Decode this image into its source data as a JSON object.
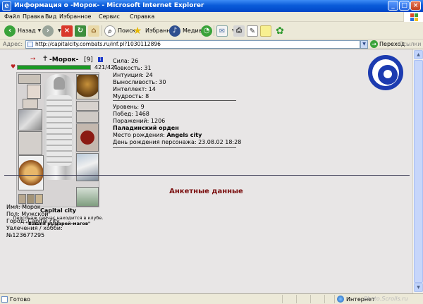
{
  "window": {
    "title": "Информация о -Морок- - Microsoft Internet Explorer",
    "controls": {
      "minimize": "_",
      "maximize": "□",
      "close": "×"
    }
  },
  "menu": [
    "Файл",
    "Правка",
    "Вид",
    "Избранное",
    "Сервис",
    "Справка"
  ],
  "toolbar": {
    "back": "Назад",
    "search": "Поиск",
    "favorites": "Избранное",
    "media": "Медиа"
  },
  "address": {
    "label": "Адрес:",
    "url": "http://capitalcity.combats.ru/inf.pl?1030112896",
    "go": "Переход",
    "links": "Ссылки"
  },
  "character": {
    "nick": "-Морок-",
    "level_badge": "[9]",
    "hp": "421/421",
    "hp_fraction": 1.0,
    "city": "Capital city",
    "club_note": "Персонаж сейчас находится в клубе.",
    "club_name": "\"Башня рыцарей-магов\""
  },
  "stats": [
    "Сила: 26",
    "Ловкость: 31",
    "Интуиция: 24",
    "Выносливость: 30",
    "Интеллект: 14",
    "Мудрость: 8"
  ],
  "record": {
    "level": "Уровень: 9",
    "wins": "Побед: 1468",
    "losses": "Поражений: 1206",
    "order": "Паладинский орден",
    "birthplace_label": "Место рождения: ",
    "birthplace_value": "Angels city",
    "birthday": "День рождения персонажа: 23.08.02 18:28"
  },
  "profile": {
    "title": "Анкетные данные",
    "name": "Имя: Морок",
    "gender": "Пол: Мужской",
    "city": "Город: Capital city",
    "hobbies": "Увлечения / хобби:",
    "icq": "№123677295"
  },
  "status": {
    "text": "Готово",
    "zone": "Интернет"
  },
  "watermark": "Photo.Scrolls.ru"
}
